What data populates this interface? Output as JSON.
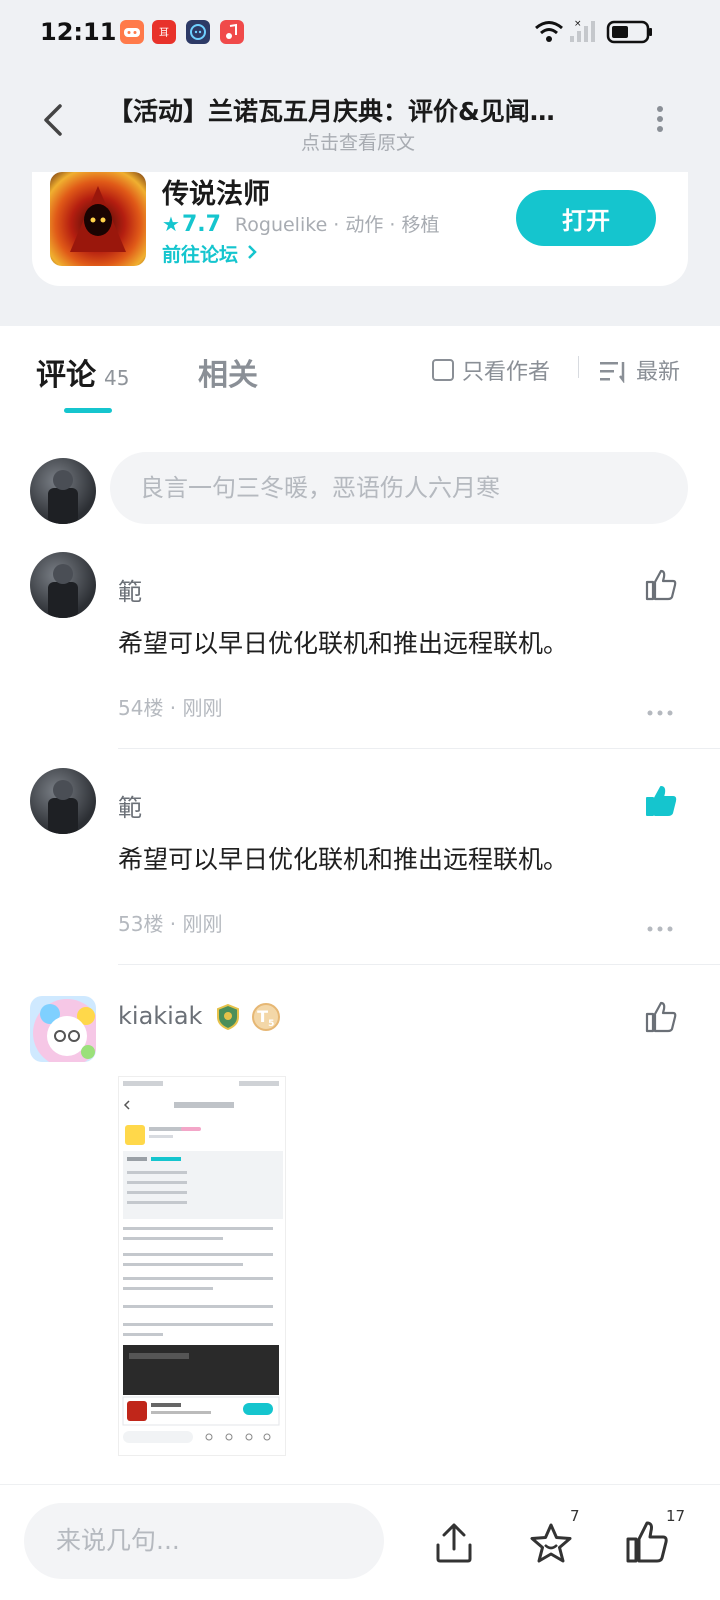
{
  "status_bar": {
    "time": "12:11"
  },
  "header": {
    "title": "【活动】兰诺瓦五月庆典：评价&见闻…",
    "subtitle": "点击查看原文"
  },
  "game": {
    "name": "传说法师",
    "rating": "7.7",
    "tags": "Roguelike · 动作 · 移植",
    "forum_link": "前往论坛",
    "open_label": "打开"
  },
  "tabs": {
    "comments_label": "评论",
    "comments_count": "45",
    "related_label": "相关",
    "author_only_label": "只看作者",
    "sort_label": "最新"
  },
  "comment_input": {
    "placeholder": "良言一句三冬暖，恶语伤人六月寒"
  },
  "comments": [
    {
      "user": "範",
      "text": "希望可以早日优化联机和推出远程联机。",
      "meta": "54楼 · 刚刚",
      "liked": false
    },
    {
      "user": "範",
      "text": "希望可以早日优化联机和推出远程联机。",
      "meta": "53楼 · 刚刚",
      "liked": true
    },
    {
      "user": "kiakiak",
      "badge_letter": "T",
      "badge_level": "5"
    }
  ],
  "bottom_bar": {
    "input_placeholder": "来说几句...",
    "fav_count": "7",
    "like_count": "17"
  },
  "colors": {
    "accent": "#15c5ce",
    "muted": "#a8acb2"
  }
}
